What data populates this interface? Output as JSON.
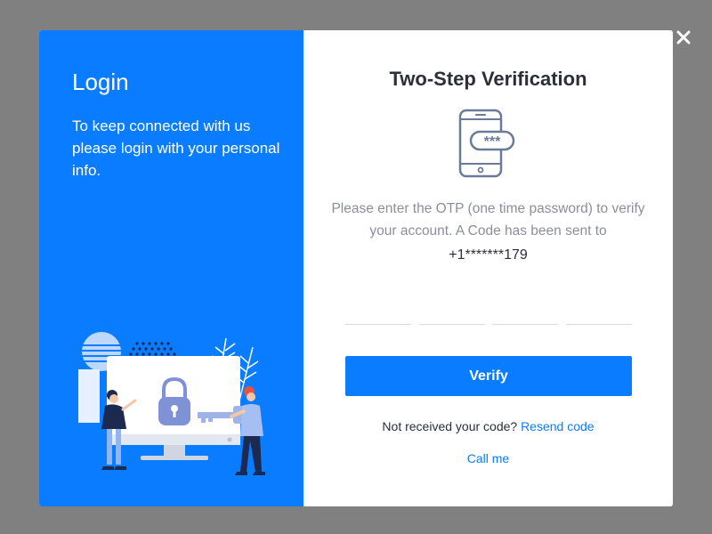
{
  "modal": {
    "close_icon": "close-icon"
  },
  "left_panel": {
    "title": "Login",
    "text": "To keep connected with us please login with your personal info.",
    "background_color": "#0a7cff",
    "illustration": "computer-lock-key-people-illustration"
  },
  "right_panel": {
    "title": "Two-Step Verification",
    "phone_icon": "phone-otp-icon",
    "description": "Please enter the OTP (one time password) to verify your account. A Code has been sent to",
    "phone_number": "+1*******179",
    "otp_inputs": [
      {
        "value": "",
        "placeholder": ""
      },
      {
        "value": "",
        "placeholder": ""
      },
      {
        "value": "",
        "placeholder": ""
      },
      {
        "value": "",
        "placeholder": ""
      }
    ],
    "verify_label": "Verify",
    "resend_prompt": "Not received your code?",
    "resend_link": "Resend code",
    "call_link": "Call me",
    "accent_color": "#0a7cff"
  }
}
